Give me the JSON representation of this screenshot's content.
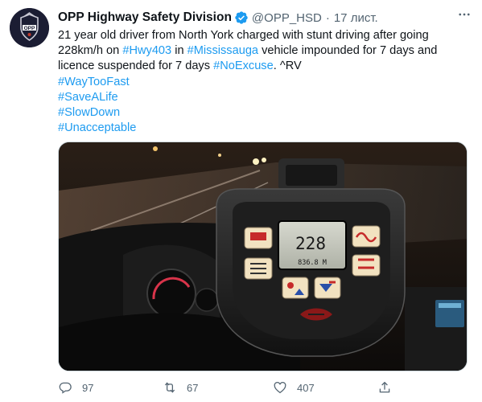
{
  "tweet": {
    "author": {
      "display_name": "OPP Highway Safety Division",
      "handle": "@OPP_HSD",
      "verified": true,
      "avatar_text": "OPP"
    },
    "separator": "·",
    "timestamp": "17 лист.",
    "body": {
      "line_1": {
        "before_first_tag": "21 year old driver from North York charged with stunt driving after going 228km/h on ",
        "tag_1": "#Hwy403",
        "between": " in ",
        "tag_2": "#Mississauga",
        "after": " vehicle impounded for 7 days and licence suspended for 7 days ",
        "tag_3": "#NoExcuse",
        "signature": ".  ^RV"
      },
      "hashtags": [
        "#WayTooFast",
        "#SaveALife",
        "#SlowDown",
        "#Unacceptable"
      ]
    },
    "media": {
      "kind": "photo",
      "radar_display": {
        "speed": "228",
        "distance": "836.8 M"
      }
    },
    "actions": {
      "reply_count": "97",
      "retweet_count": "67",
      "like_count": "407"
    },
    "icons": {
      "verified": "verified-badge-icon",
      "more": "more-options-icon",
      "reply": "reply-icon",
      "retweet": "retweet-icon",
      "like": "like-icon",
      "share": "share-icon"
    },
    "colors": {
      "link": "#1d9bf0",
      "text": "#0f1419",
      "secondary": "#536471"
    }
  }
}
